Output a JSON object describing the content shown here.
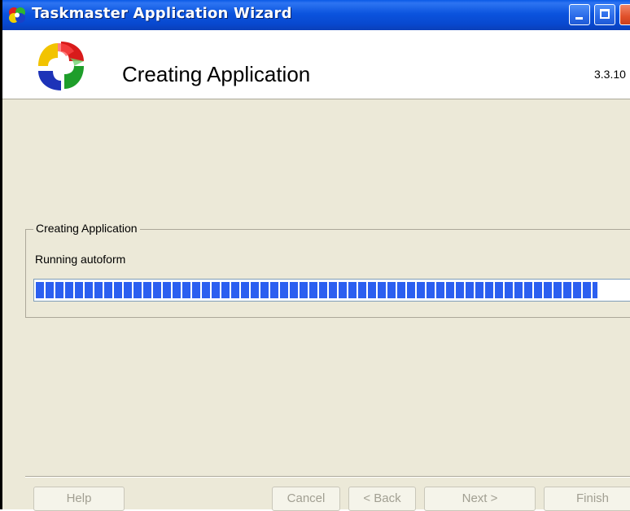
{
  "window": {
    "title": "Taskmaster Application Wizard"
  },
  "header": {
    "title": "Creating Application",
    "version": "3.3.10"
  },
  "group": {
    "legend": "Creating Application",
    "status": "Running autoform"
  },
  "progress": {
    "fraction": 0.94,
    "color": "#2c5ff0"
  },
  "buttons": {
    "help": "Help",
    "cancel": "Cancel",
    "back": "< Back",
    "next": "Next >",
    "finish": "Finish"
  },
  "icons": {
    "app": "taskmaster-logo-icon",
    "minimize": "minimize-icon",
    "maximize": "maximize-icon",
    "close": "close-icon"
  }
}
